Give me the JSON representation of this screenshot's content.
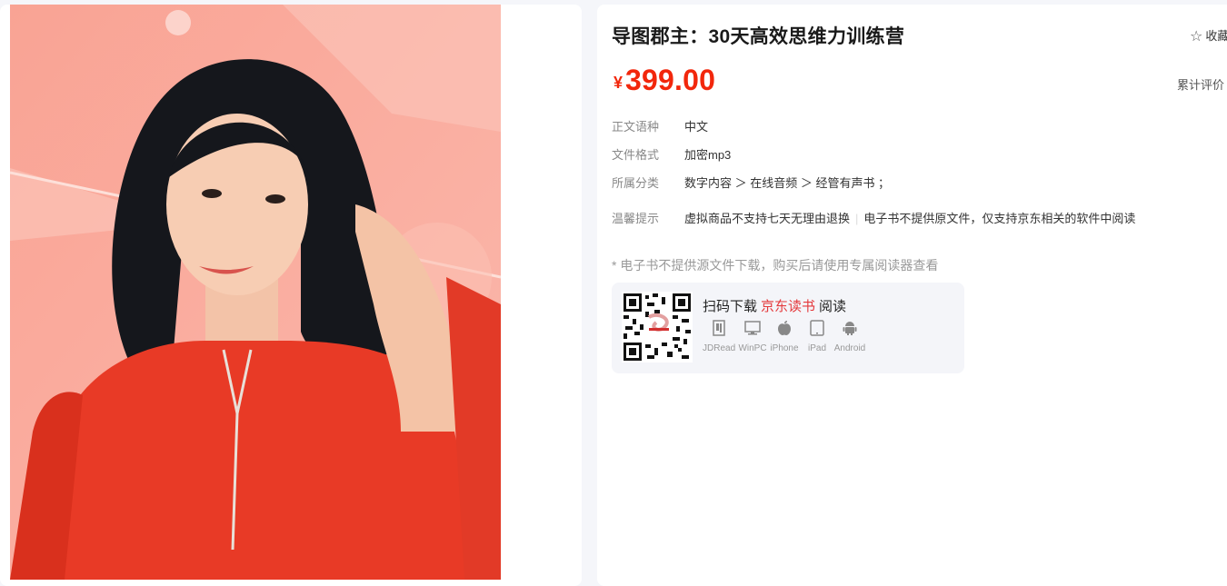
{
  "product": {
    "title": "导图郡主：30天高效思维力训练营",
    "favorite_label": "收藏",
    "currency": "¥",
    "price": "399.00",
    "review_label": "累计评价",
    "info": [
      {
        "key": "正文语种",
        "value": "中文"
      },
      {
        "key": "文件格式",
        "value": "加密mp3"
      },
      {
        "key": "所属分类",
        "value": "数字内容 ＞ 在线音频 ＞ 经管有声书 ；"
      }
    ],
    "tips_key": "温馨提示",
    "tip1": "虚拟商品不支持七天无理由退换",
    "tip_sep": "|",
    "tip2": "电子书不提供原文件，仅支持京东相关的软件中阅读",
    "download_note": "* 电子书不提供源文件下载，购买后请使用专属阅读器查看"
  },
  "reader": {
    "scan_prefix": "扫码下载",
    "brand": "京东读书",
    "scan_suffix": "阅读",
    "platforms": [
      {
        "label": "JDRead",
        "icon": "jdread-icon"
      },
      {
        "label": "WinPC",
        "icon": "monitor-icon"
      },
      {
        "label": "iPhone",
        "icon": "apple-icon"
      },
      {
        "label": "iPad",
        "icon": "tablet-icon"
      },
      {
        "label": "Android",
        "icon": "android-icon"
      }
    ]
  },
  "colors": {
    "price": "#f2270c",
    "brand": "#e4393c",
    "cover_bg": "#f8a69a"
  }
}
